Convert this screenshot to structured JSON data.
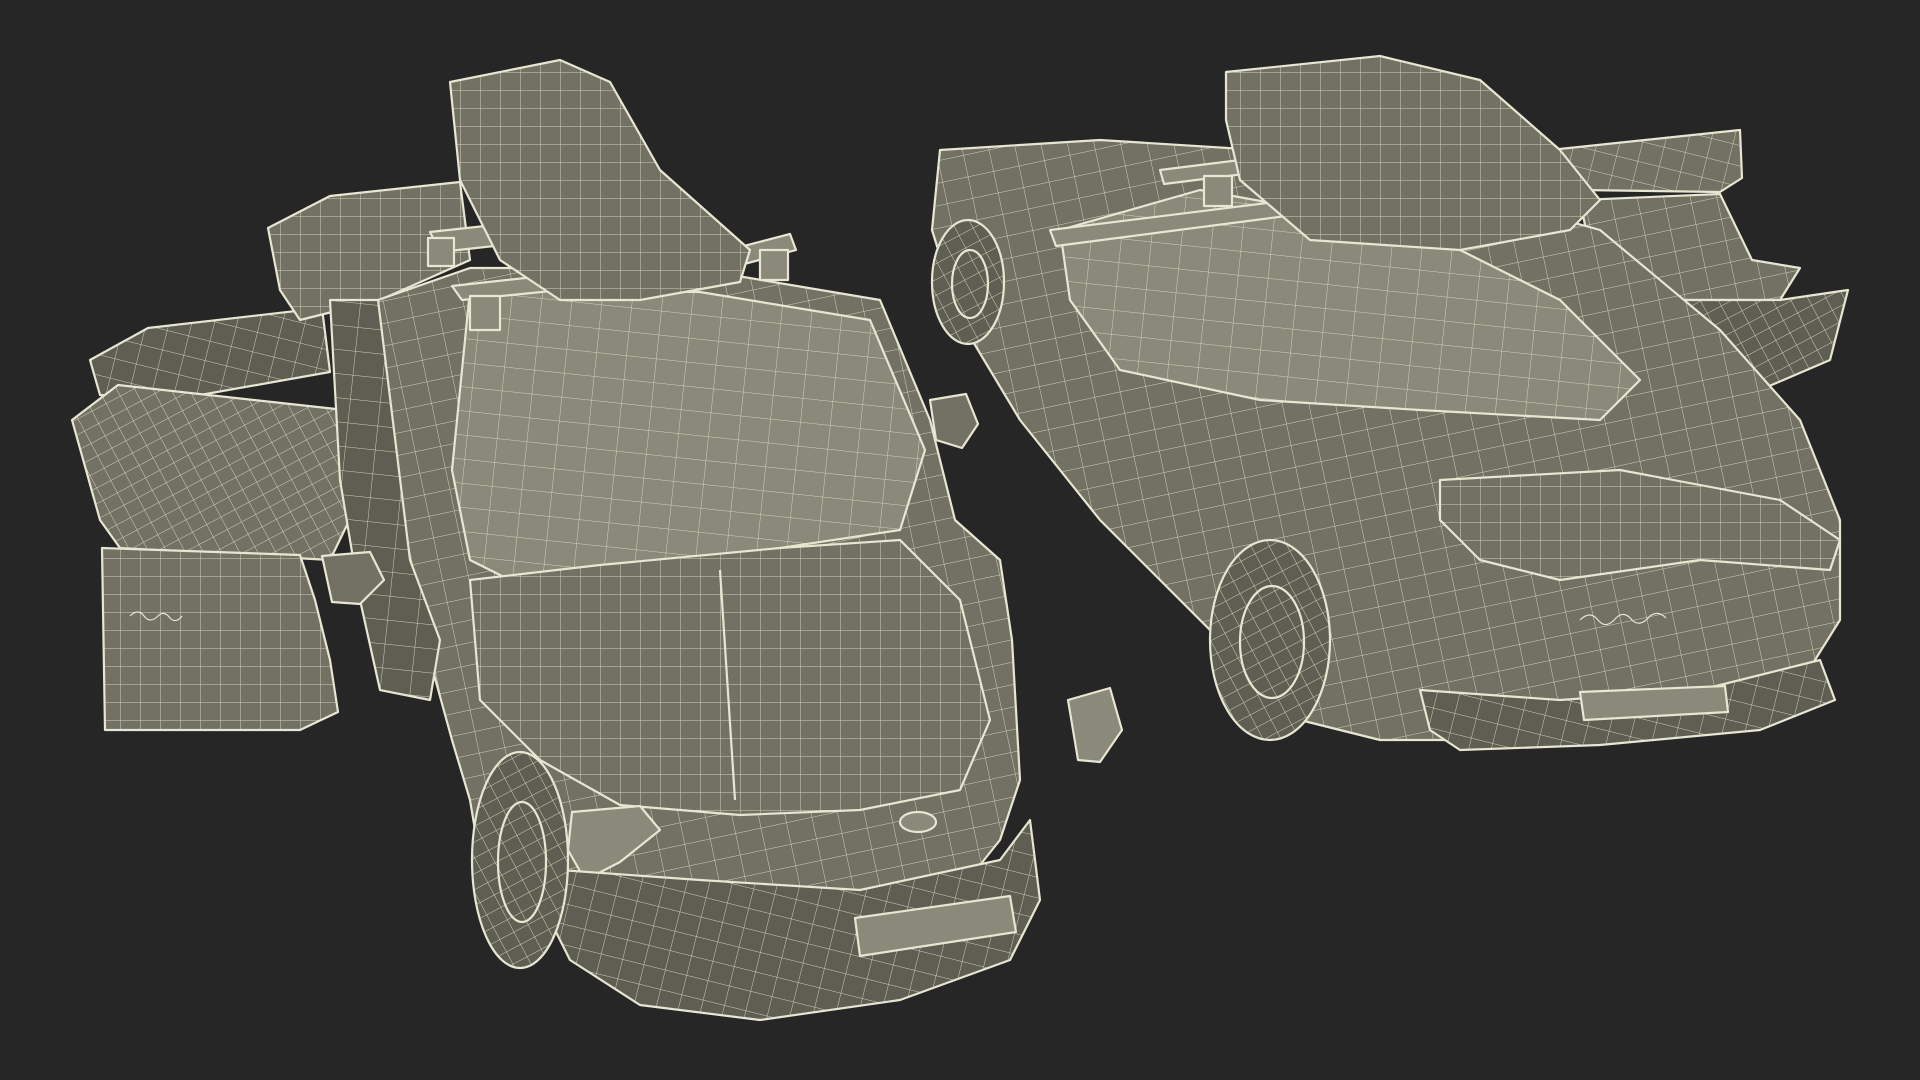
{
  "scene": {
    "background_color": "#262626",
    "mesh_fill_color": "#727163",
    "wire_color": "#e6e6d2",
    "render_style": "wireframe-over-shaded",
    "models": [
      {
        "view": "front-three-quarter",
        "doors": "open",
        "roof_box": true
      },
      {
        "view": "rear-three-quarter",
        "doors": "open",
        "roof_box": true
      }
    ]
  }
}
